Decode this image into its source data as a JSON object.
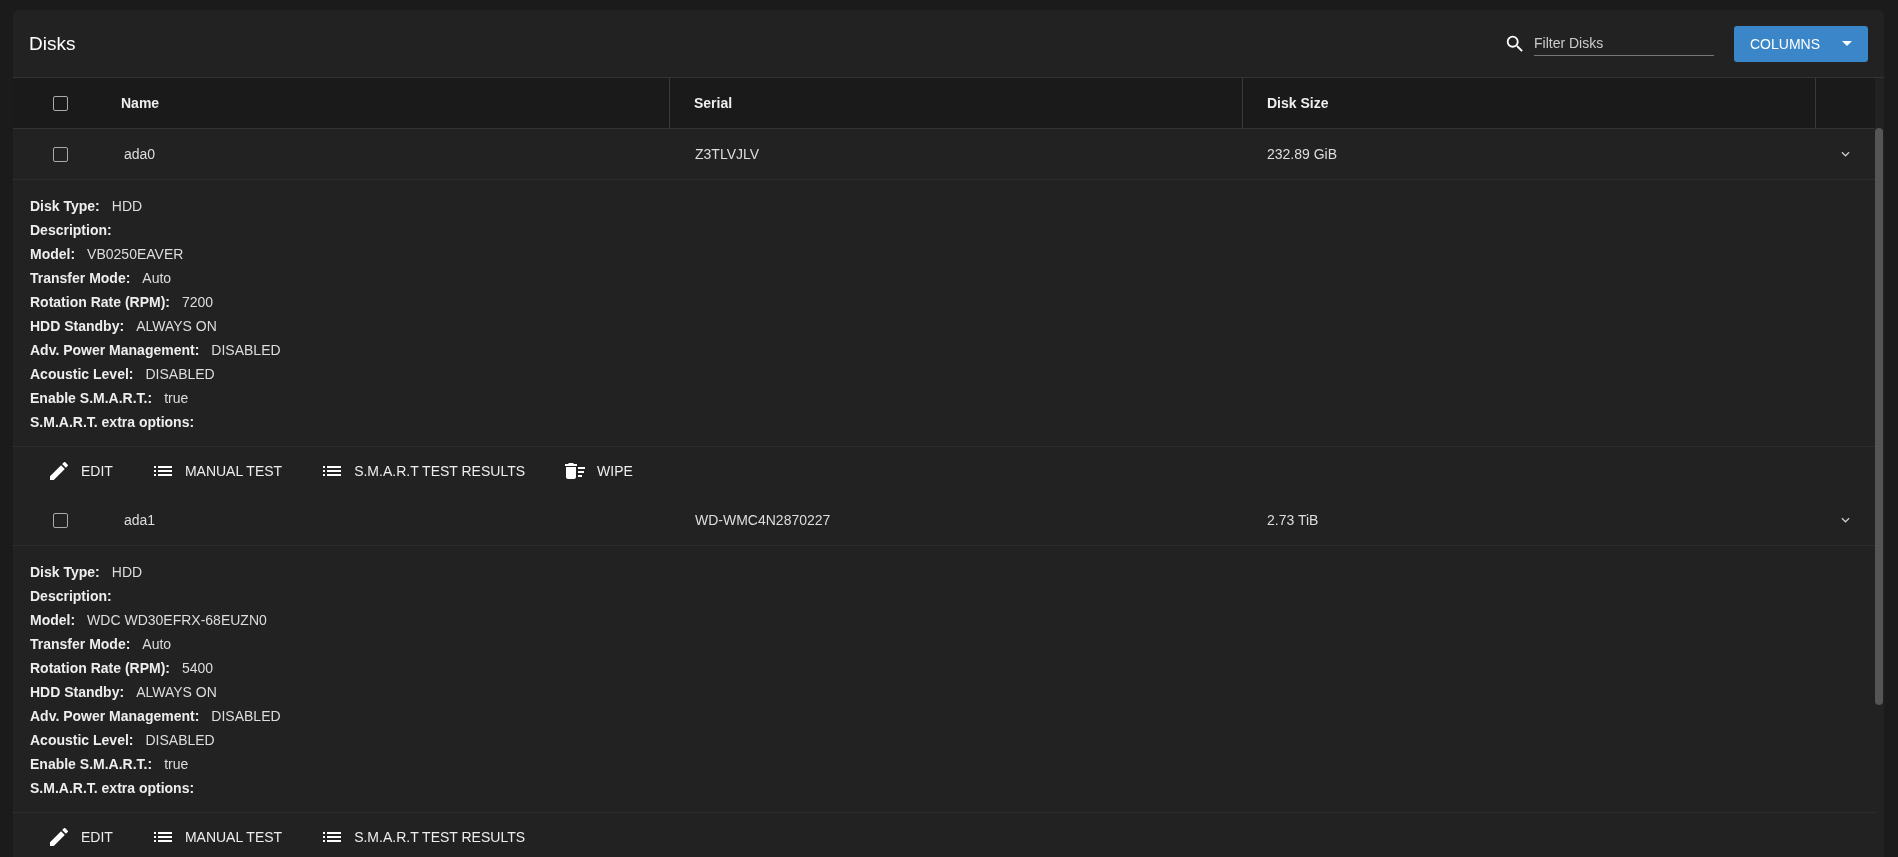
{
  "title": "Disks",
  "search": {
    "placeholder": "Filter Disks"
  },
  "columns_button": {
    "label": "COLUMNS"
  },
  "table": {
    "select_all": {
      "checked": false
    },
    "columns": [
      "Name",
      "Serial",
      "Disk Size"
    ],
    "rows": [
      {
        "name": "ada0",
        "serial": "Z3TLVJLV",
        "size": "232.89 GiB",
        "checked": false,
        "expanded": true,
        "details": [
          {
            "label": "Disk Type:",
            "value": "HDD"
          },
          {
            "label": "Description:"
          },
          {
            "label": "Model:",
            "value": "VB0250EAVER"
          },
          {
            "label": "Transfer Mode:",
            "value": "Auto"
          },
          {
            "label": "Rotation Rate (RPM):",
            "value": "7200"
          },
          {
            "label": "HDD Standby:",
            "value": "ALWAYS ON"
          },
          {
            "label": "Adv. Power Management:",
            "value": "DISABLED"
          },
          {
            "label": "Acoustic Level:",
            "value": "DISABLED"
          },
          {
            "label": "Enable S.M.A.R.T.:",
            "value": "true"
          },
          {
            "label": "S.M.A.R.T. extra options:"
          }
        ],
        "actions": [
          {
            "kind": "edit",
            "label": "EDIT"
          },
          {
            "kind": "list",
            "label": "MANUAL TEST"
          },
          {
            "kind": "list",
            "label": "S.M.A.R.T TEST RESULTS"
          },
          {
            "kind": "wipe",
            "label": "WIPE"
          }
        ]
      },
      {
        "name": "ada1",
        "serial": "WD-WMC4N2870227",
        "size": "2.73 TiB",
        "checked": false,
        "expanded": true,
        "details": [
          {
            "label": "Disk Type:",
            "value": "HDD"
          },
          {
            "label": "Description:"
          },
          {
            "label": "Model:",
            "value": "WDC WD30EFRX-68EUZN0"
          },
          {
            "label": "Transfer Mode:",
            "value": "Auto"
          },
          {
            "label": "Rotation Rate (RPM):",
            "value": "5400"
          },
          {
            "label": "HDD Standby:",
            "value": "ALWAYS ON"
          },
          {
            "label": "Adv. Power Management:",
            "value": "DISABLED"
          },
          {
            "label": "Acoustic Level:",
            "value": "DISABLED"
          },
          {
            "label": "Enable S.M.A.R.T.:",
            "value": "true"
          },
          {
            "label": "S.M.A.R.T. extra options:"
          }
        ],
        "actions": [
          {
            "kind": "edit",
            "label": "EDIT"
          },
          {
            "kind": "list",
            "label": "MANUAL TEST"
          },
          {
            "kind": "list",
            "label": "S.M.A.R.T TEST RESULTS"
          }
        ]
      }
    ]
  }
}
